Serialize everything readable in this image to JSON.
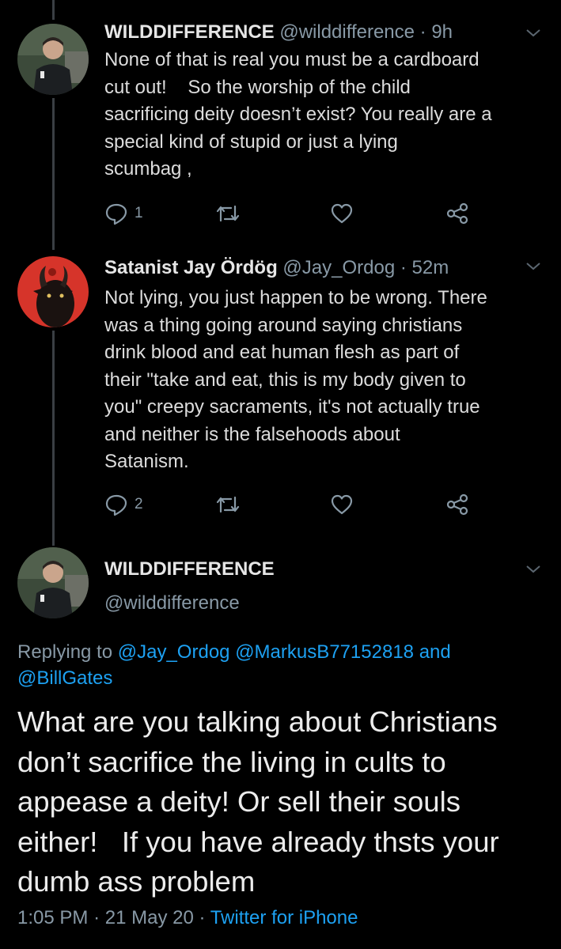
{
  "tweet1": {
    "display_name": "WILDDIFFERENCE",
    "handle": "@wilddifference",
    "time": "· 9h",
    "lines": [
      "None of that is real you must be a cardboard",
      "cut out!    So the worship of the child",
      "sacrificing deity doesn’t exist? You really are a",
      "special kind of stupid or just a lying",
      "scumbag ,"
    ],
    "reply_count": "1"
  },
  "tweet2": {
    "display_name": "Satanist Jay Ördög",
    "handle": "@Jay_Ordog",
    "time": "· 52m",
    "lines": [
      "Not lying, you just happen to be wrong. There",
      "was a thing going around saying christians",
      "drink blood and eat human flesh as part of",
      "their \"take and eat, this is my body given to",
      "you\" creepy sacraments, it's not actually true",
      "and neither is the falsehoods about",
      "Satanism."
    ],
    "reply_count": "2"
  },
  "main_tweet": {
    "display_name": "WILDDIFFERENCE",
    "handle": "@wilddifference",
    "replying_prefix": "Replying to",
    "mention1": "@Jay_Ordog",
    "mention2": "@MarkusB77152818",
    "and_word": "and",
    "mention3": "@BillGates",
    "lines": [
      "What are you talking about Christians",
      "don’t sacrifice the living in cults to",
      "appease a deity! Or sell their souls",
      "either!   If you have already thsts your",
      "dumb ass problem"
    ],
    "time": "1:05 PM",
    "date": "21 May 20",
    "separator": "·",
    "client": "Twitter for iPhone"
  },
  "colors": {
    "background": "#000000",
    "link": "#1da1f2",
    "muted": "#8899a6"
  },
  "icons": [
    "reply-icon",
    "retweet-icon",
    "like-icon",
    "share-icon",
    "chevron-down-icon"
  ]
}
